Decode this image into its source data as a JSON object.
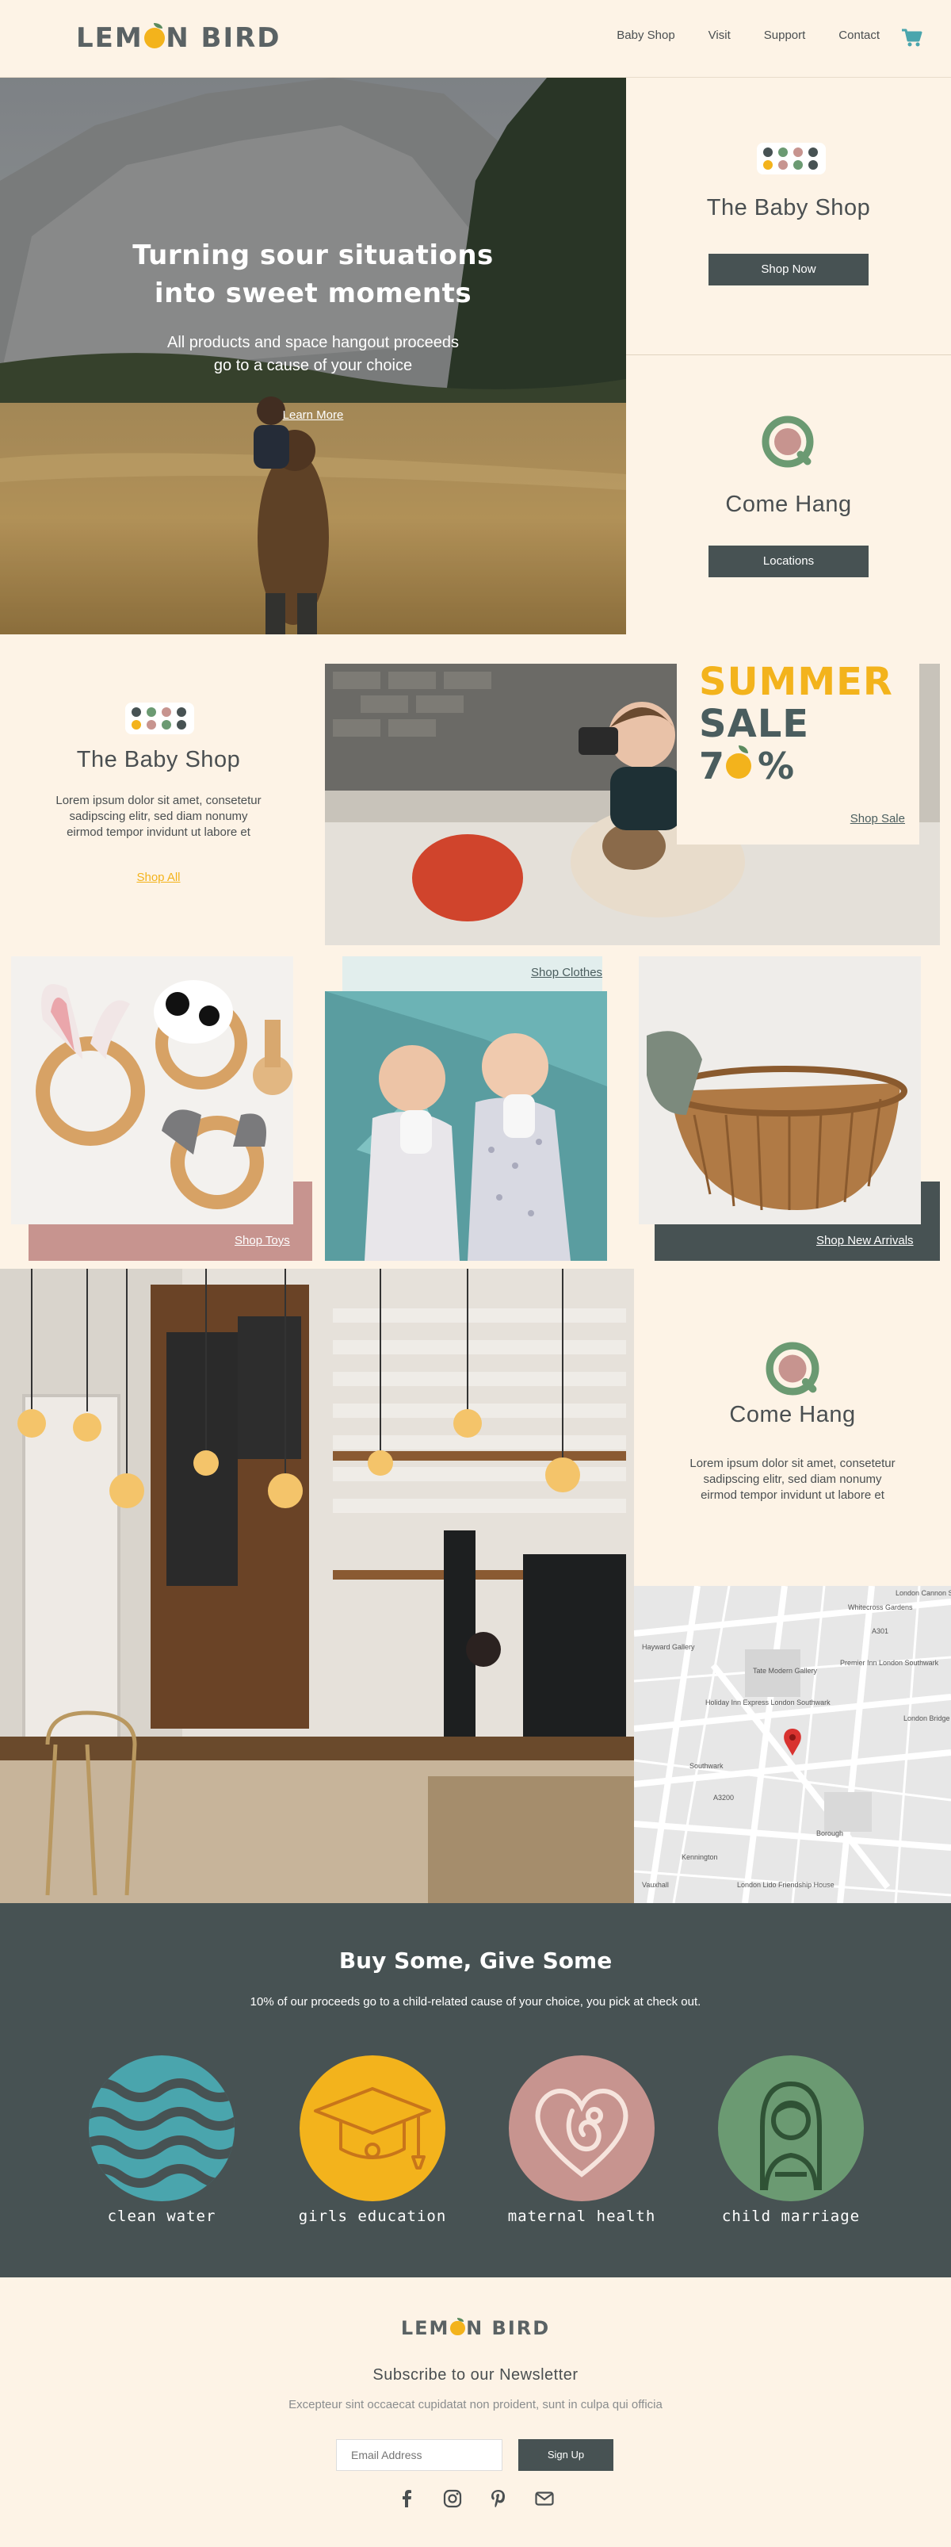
{
  "colors": {
    "cream": "#fdf3e6",
    "slate": "#475253",
    "yellow": "#f3b31c",
    "teal": "#4aa5ad",
    "pink": "#c7948f",
    "green": "#6b9a72"
  },
  "brand": {
    "name_a": "LEM",
    "name_b": "N BIRD"
  },
  "nav": {
    "items": [
      "Baby Shop",
      "Visit",
      "Support",
      "Contact"
    ],
    "cart_icon": "shopping-cart-icon"
  },
  "hero": {
    "title_line1": "Turning sour situations",
    "title_line2": "into sweet moments",
    "subtitle_line1": "All products and space hangout proceeds",
    "subtitle_line2": "go to a cause of your choice",
    "cta": "Learn More"
  },
  "side_baby": {
    "title": "The Baby Shop",
    "button": "Shop Now"
  },
  "side_hang": {
    "title": "Come Hang",
    "button": "Locations"
  },
  "baby_block": {
    "title": "The Baby Shop",
    "text_line1": "Lorem ipsum dolor sit amet, consetetur",
    "text_line2": "sadipscing elitr, sed diam nonumy",
    "text_line3": "eirmod tempor invidunt ut labore et",
    "link": "Shop All"
  },
  "sale": {
    "line1": "SUMMER",
    "line2": "SALE",
    "digit1": "7",
    "percent": "%",
    "link": "Shop Sale"
  },
  "products": {
    "toys": "Shop Toys",
    "clothes": "Shop Clothes",
    "new": "Shop New Arrivals"
  },
  "hang_block": {
    "title": "Come Hang",
    "text_line1": "Lorem ipsum dolor sit amet, consetetur",
    "text_line2": "sadipscing elitr, sed diam nonumy",
    "text_line3": "eirmod tempor invidunt ut labore et"
  },
  "map": {
    "labels": [
      "Whitecross Gardens",
      "London Cannon Street",
      "Tate Modern Gallery",
      "Premier Inn London Southwark",
      "London Bridge",
      "Holiday Inn Express London Southwark",
      "Hayward Gallery",
      "Vauxhall",
      "Southwark",
      "Borough",
      "Kennington",
      "London Lido Friendship House",
      "A3200",
      "A301"
    ]
  },
  "causes": {
    "title": "Buy Some, Give Some",
    "subtitle": "10% of our proceeds go to a child-related cause of your choice, you pick at check out.",
    "items": [
      {
        "label": "clean water",
        "icon": "water-waves-icon",
        "color": "#4aa5ad"
      },
      {
        "label": "girls education",
        "icon": "graduation-cap-icon",
        "color": "#f3b31c"
      },
      {
        "label": "maternal health",
        "icon": "pregnant-heart-icon",
        "color": "#c7948f"
      },
      {
        "label": "child marriage",
        "icon": "bride-icon",
        "color": "#6b9a72"
      }
    ]
  },
  "footer": {
    "newsletter_title": "Subscribe to our Newsletter",
    "newsletter_text": "Excepteur sint occaecat cupidatat non proident, sunt in culpa qui officia",
    "email_placeholder": "Email Address",
    "signup": "Sign Up",
    "social": [
      "facebook-icon",
      "instagram-icon",
      "pinterest-icon",
      "mail-icon"
    ]
  }
}
